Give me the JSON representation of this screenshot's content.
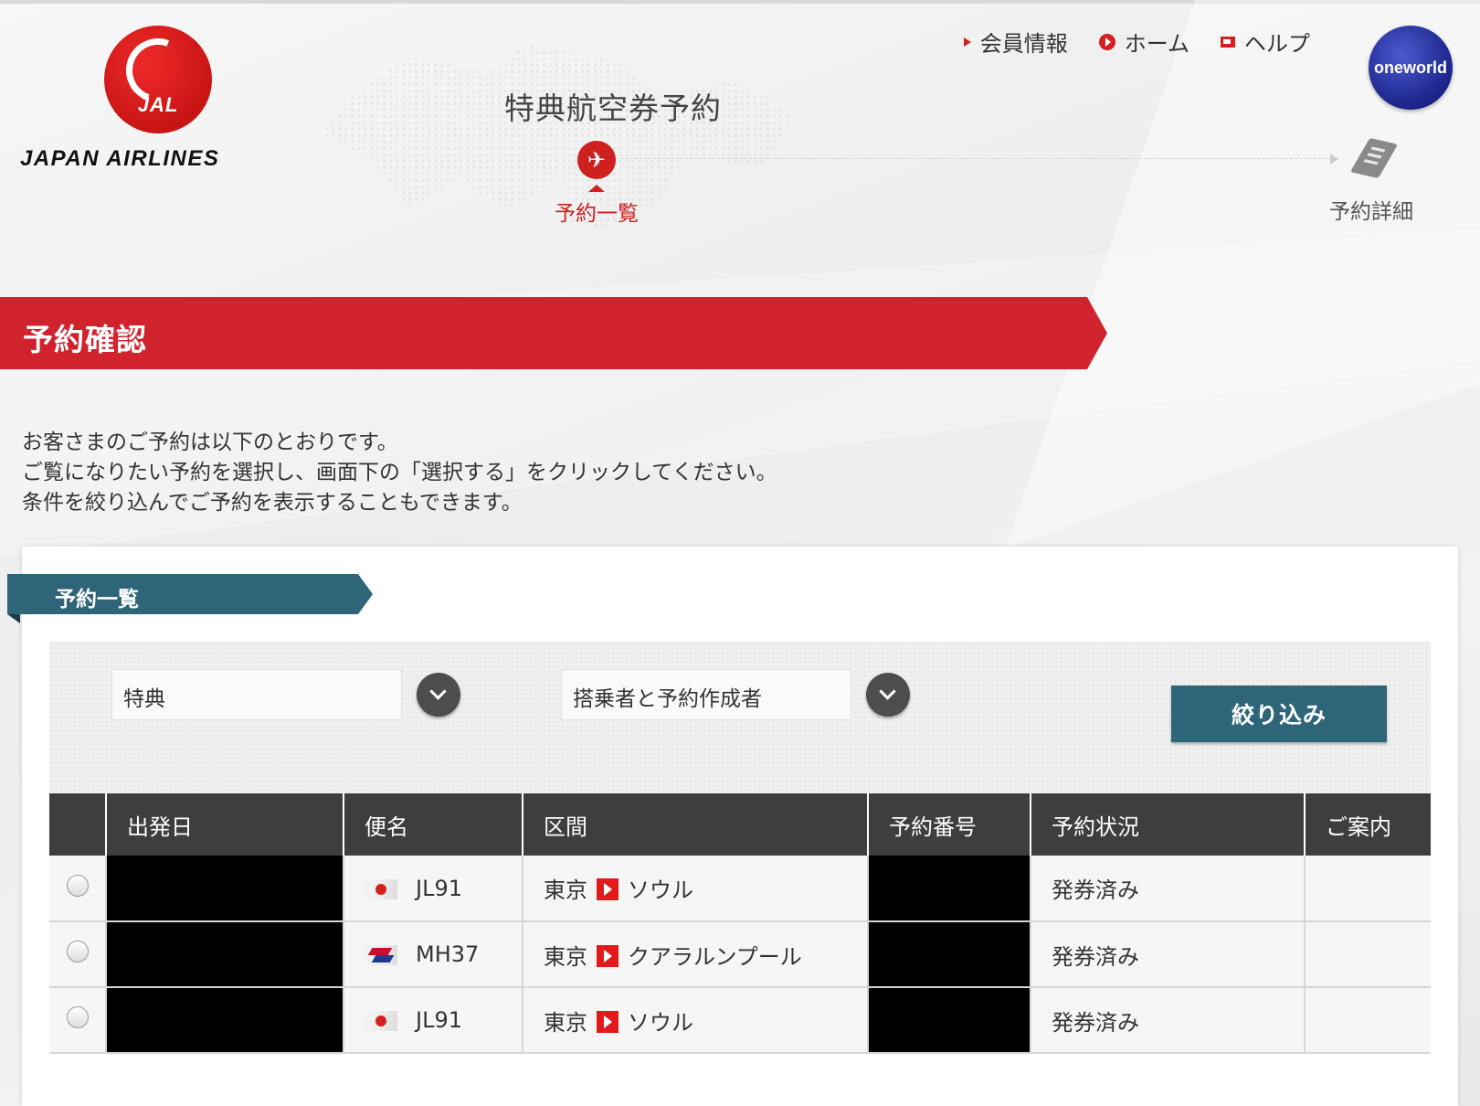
{
  "header": {
    "page_heading": "特典航空券予約",
    "logo_text": "JAPAN AIRLINES",
    "logo_mark_text": "JAL",
    "alliance_badge": "oneworld",
    "nav": [
      {
        "label": "会員情報",
        "icon": "triangle-right-icon"
      },
      {
        "label": "ホーム",
        "icon": "play-circle-icon"
      },
      {
        "label": "ヘルプ",
        "icon": "window-icon"
      }
    ]
  },
  "stepper": {
    "steps": [
      {
        "label": "予約一覧",
        "icon": "airplane-icon",
        "active": true
      },
      {
        "label": "予約詳細",
        "icon": "ticket-icon",
        "active": false
      }
    ]
  },
  "banner": {
    "title": "予約確認"
  },
  "intro": {
    "lines": [
      "お客さまのご予約は以下のとおりです。",
      "ご覧になりたい予約を選択し、画面下の「選択する」をクリックしてください。",
      "条件を絞り込んでご予約を表示することもできます。"
    ]
  },
  "section": {
    "title": "予約一覧"
  },
  "filters": {
    "type_select": "特典",
    "person_select": "搭乗者と予約作成者",
    "apply_label": "絞り込み"
  },
  "table": {
    "headers": [
      "出発日",
      "便名",
      "区間",
      "予約番号",
      "予約状況",
      "ご案内"
    ],
    "rows": [
      {
        "flight": "JL91",
        "airline": "JAL",
        "from": "東京",
        "to": "ソウル",
        "status": "発券済み"
      },
      {
        "flight": "MH37",
        "airline": "Malaysia Airlines",
        "from": "東京",
        "to": "クアラルンプール",
        "status": "発券済み"
      },
      {
        "flight": "JL91",
        "airline": "JAL",
        "from": "東京",
        "to": "ソウル",
        "status": "発券済み"
      }
    ]
  },
  "colors": {
    "brand_red": "#d0232e",
    "section_teal": "#2f6578",
    "table_header": "#3e3e3e",
    "oneworld_blue": "#1c2389"
  }
}
